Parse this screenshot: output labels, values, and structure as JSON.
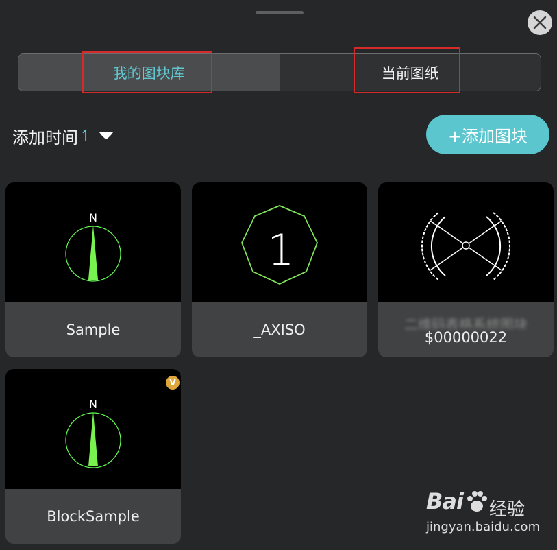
{
  "tabs": [
    {
      "label": "我的图块库",
      "active": true
    },
    {
      "label": "当前图纸",
      "active": false
    }
  ],
  "sort": {
    "label": "添加时间",
    "direction_glyph": "↿"
  },
  "add_button": {
    "label": "+添加图块"
  },
  "blocks": [
    {
      "name": "Sample",
      "thumb_icon": "compass-north-icon",
      "north_label": "N"
    },
    {
      "name": "_AXISO",
      "thumb_icon": "octagon-axis-icon",
      "axis_label": "1"
    },
    {
      "name_line1": "二维码表格系统图块",
      "name": "$00000022",
      "thumb_icon": "bowtie-symbol-icon"
    },
    {
      "name": "BlockSample",
      "thumb_icon": "compass-north-icon",
      "north_label": "N",
      "badge": "V"
    }
  ],
  "watermark": {
    "brand": "Bai",
    "brand_tail": "经验",
    "url": "jingyan.baidu.com"
  },
  "colors": {
    "accent": "#5cc6cf",
    "highlight": "#d42a2a",
    "thumb_bg": "#000000",
    "line_green": "#66ff55"
  }
}
